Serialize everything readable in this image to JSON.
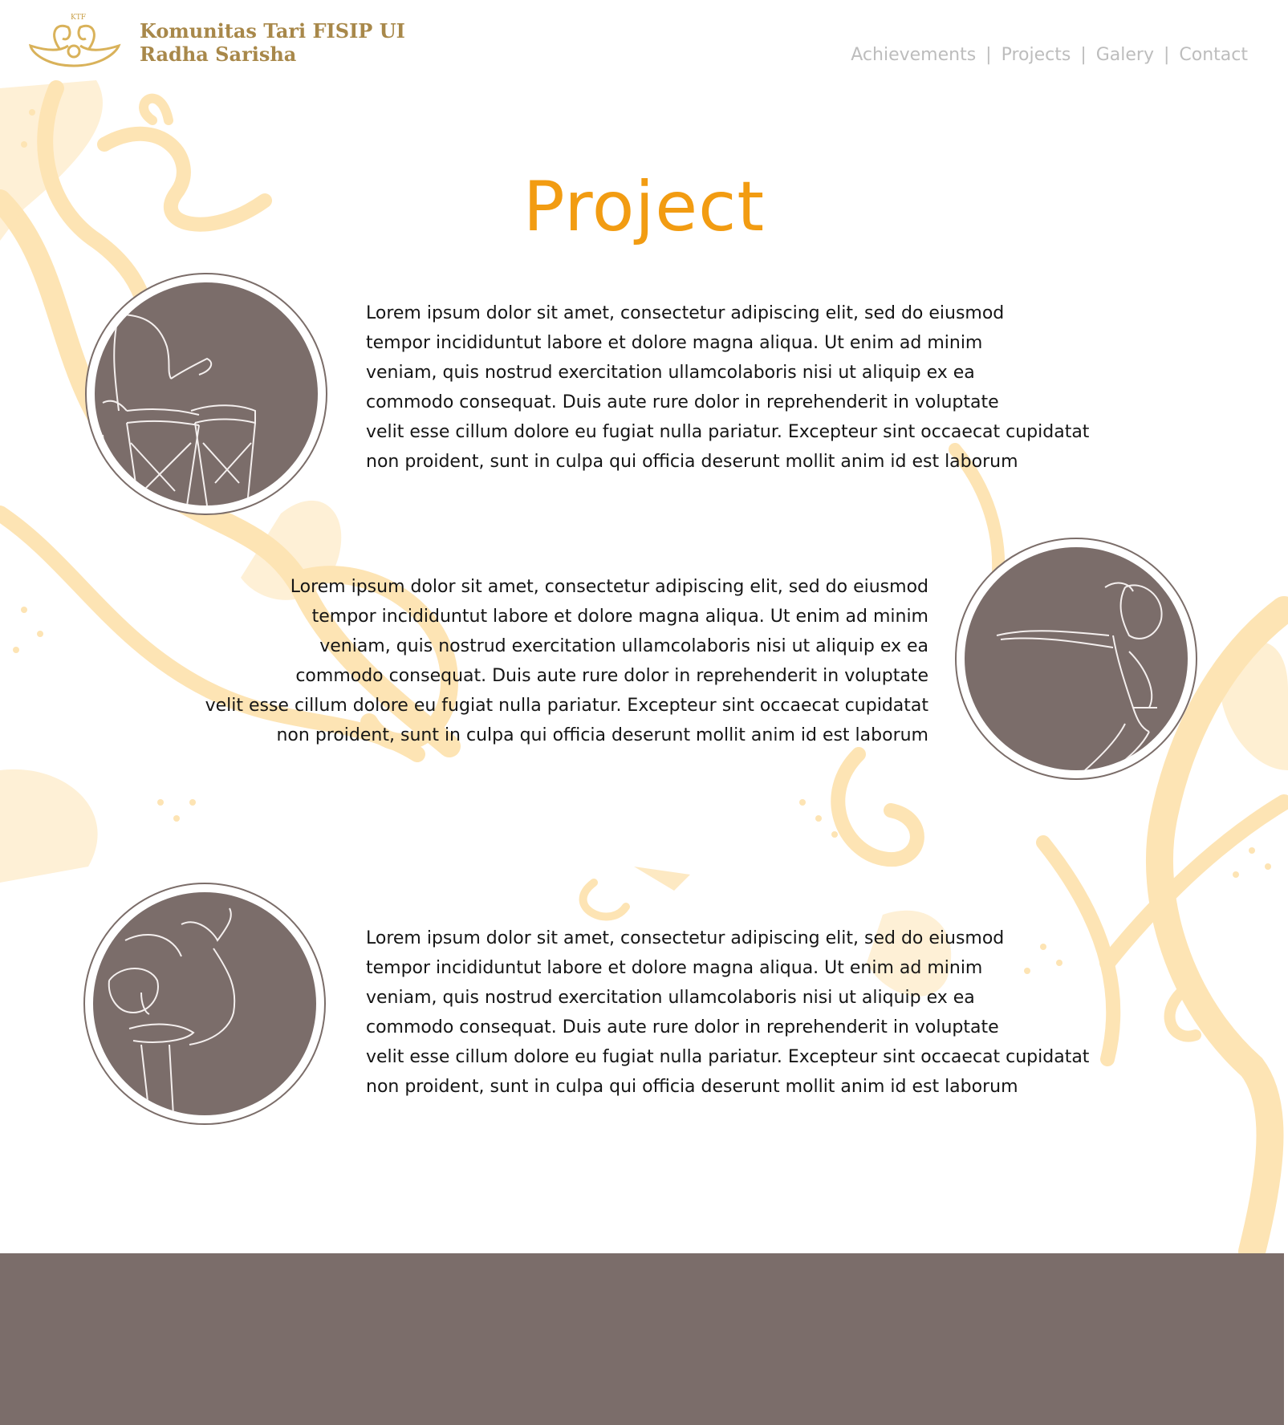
{
  "header": {
    "brand_line1": "Komunitas Tari FISIP UI",
    "brand_line2": "Radha Sarisha",
    "logo_text": "KTF",
    "nav": [
      "Achievements",
      "Projects",
      "Galery",
      "Contact"
    ]
  },
  "page": {
    "title": "Project"
  },
  "projects": [
    {
      "illustration": "drummer-illustration",
      "lines": [
        "Lorem ipsum dolor sit amet, consectetur adipiscing elit, sed do eiusmod",
        "tempor incididuntut labore et dolore magna aliqua. Ut enim ad minim",
        "veniam, quis nostrud exercitation ullamcolaboris nisi ut aliquip ex ea",
        "commodo consequat. Duis aute rure dolor in reprehenderit in voluptate",
        "velit esse cillum dolore eu fugiat nulla pariatur. Excepteur sint occaecat cupidatat",
        "non proident, sunt in culpa qui officia deserunt mollit anim id est laborum"
      ]
    },
    {
      "illustration": "dancer-illustration",
      "lines": [
        "Lorem ipsum dolor sit amet, consectetur adipiscing elit, sed do eiusmod",
        "tempor incididuntut labore et dolore magna aliqua. Ut enim ad minim",
        "veniam, quis nostrud exercitation ullamcolaboris nisi ut aliquip ex ea",
        "commodo consequat. Duis aute rure dolor in reprehenderit in voluptate",
        "velit esse cillum dolore eu fugiat nulla pariatur. Excepteur sint occaecat cupidatat",
        "non proident, sunt in culpa qui officia deserunt mollit anim id est laborum"
      ]
    },
    {
      "illustration": "fan-dancer-illustration",
      "lines": [
        "Lorem ipsum dolor sit amet, consectetur adipiscing elit, sed do eiusmod",
        "tempor incididuntut labore et dolore magna aliqua. Ut enim ad minim",
        "veniam, quis nostrud exercitation ullamcolaboris nisi ut aliquip ex ea",
        "commodo consequat. Duis aute rure dolor in reprehenderit in voluptate",
        "velit esse cillum dolore eu fugiat nulla pariatur. Excepteur sint occaecat cupidatat",
        "non proident, sunt in culpa qui officia deserunt mollit anim id est laborum"
      ]
    }
  ],
  "colors": {
    "title": "#f29c12",
    "brand": "#a8884a",
    "nav": "#bdbdbd",
    "circle_fill": "#7b6d6a",
    "footer": "#7b6d6a",
    "ornament": "#fde4b4"
  }
}
